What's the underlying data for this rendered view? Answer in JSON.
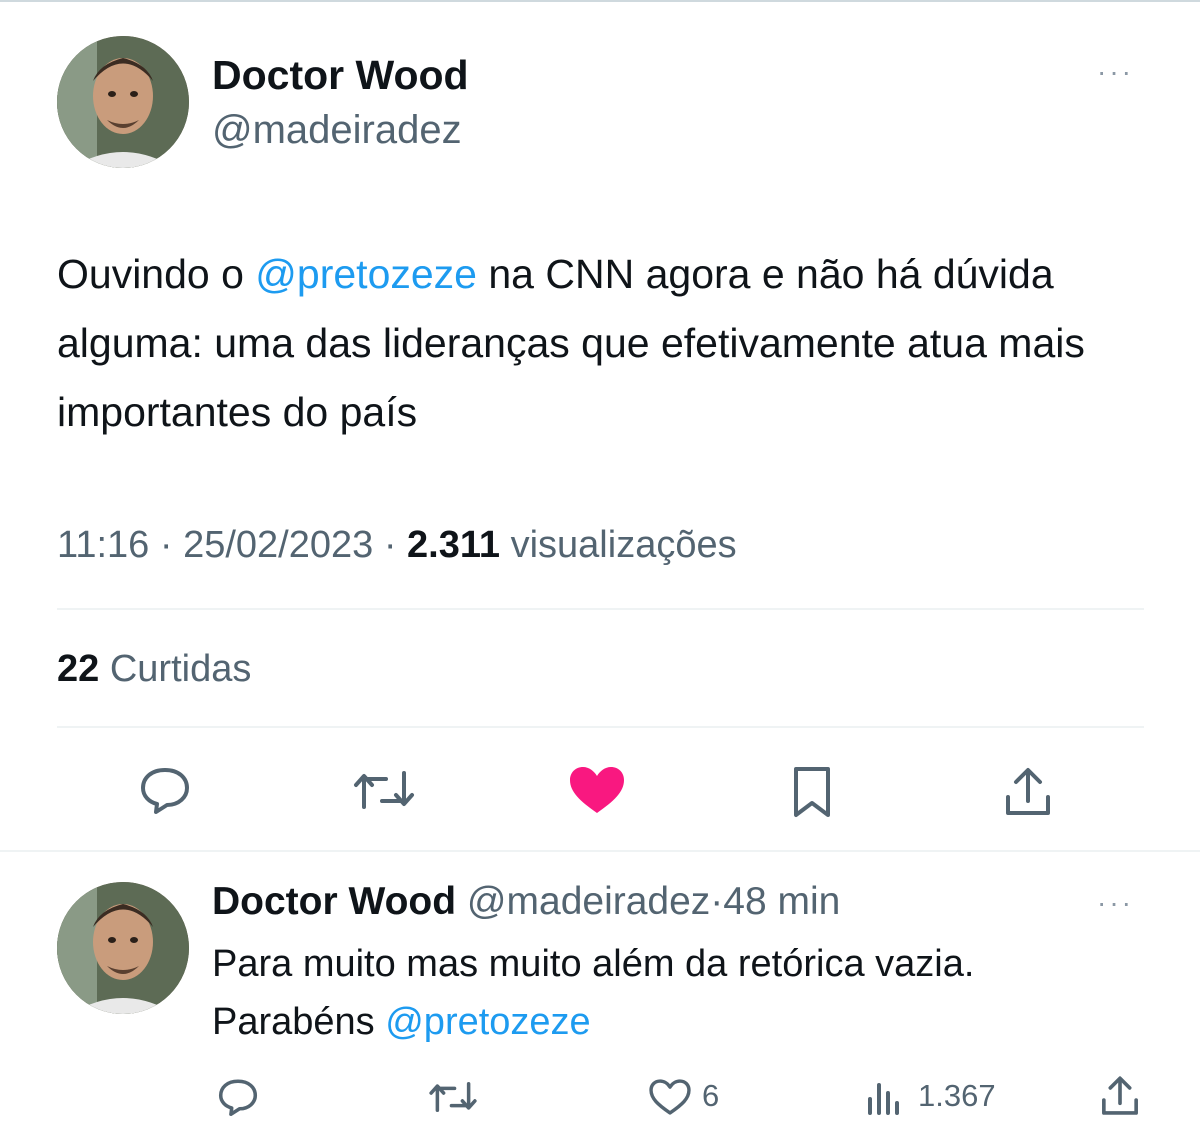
{
  "main_tweet": {
    "author_name": "Doctor Wood",
    "author_handle": "@madeiradez",
    "more": "···",
    "text_parts": {
      "p1": "Ouvindo o ",
      "mention": "@pretozeze",
      "p2": " na CNN agora e não há dúvida alguma: uma das lideranças que efetivamente atua mais importantes do país"
    },
    "time": "11:16",
    "sep": "·",
    "date": "25/02/2023",
    "views_count": "2.311",
    "views_label": "visualizações",
    "likes_count": "22",
    "likes_label": "Curtidas",
    "actions": [
      "reply-icon",
      "retweet-icon",
      "like-icon-filled",
      "bookmark-icon",
      "share-icon"
    ],
    "liked_color": "#f91880"
  },
  "reply": {
    "author_name": "Doctor Wood",
    "author_handle": "@madeiradez",
    "sep": "·",
    "time_ago": "48 min",
    "more": "···",
    "text_line1": "Para muito mas muito além da retórica vazia.",
    "text_line2_prefix": "Parabéns ",
    "mention": "@pretozeze",
    "like_count": "6",
    "views_count": "1.367",
    "actions": [
      "reply-icon",
      "retweet-icon",
      "like-icon",
      "views-icon",
      "share-icon"
    ]
  },
  "colors": {
    "text": "#0f1419",
    "secondary": "#536471",
    "mention": "#1d9bf0",
    "divider": "#eff3f4"
  }
}
